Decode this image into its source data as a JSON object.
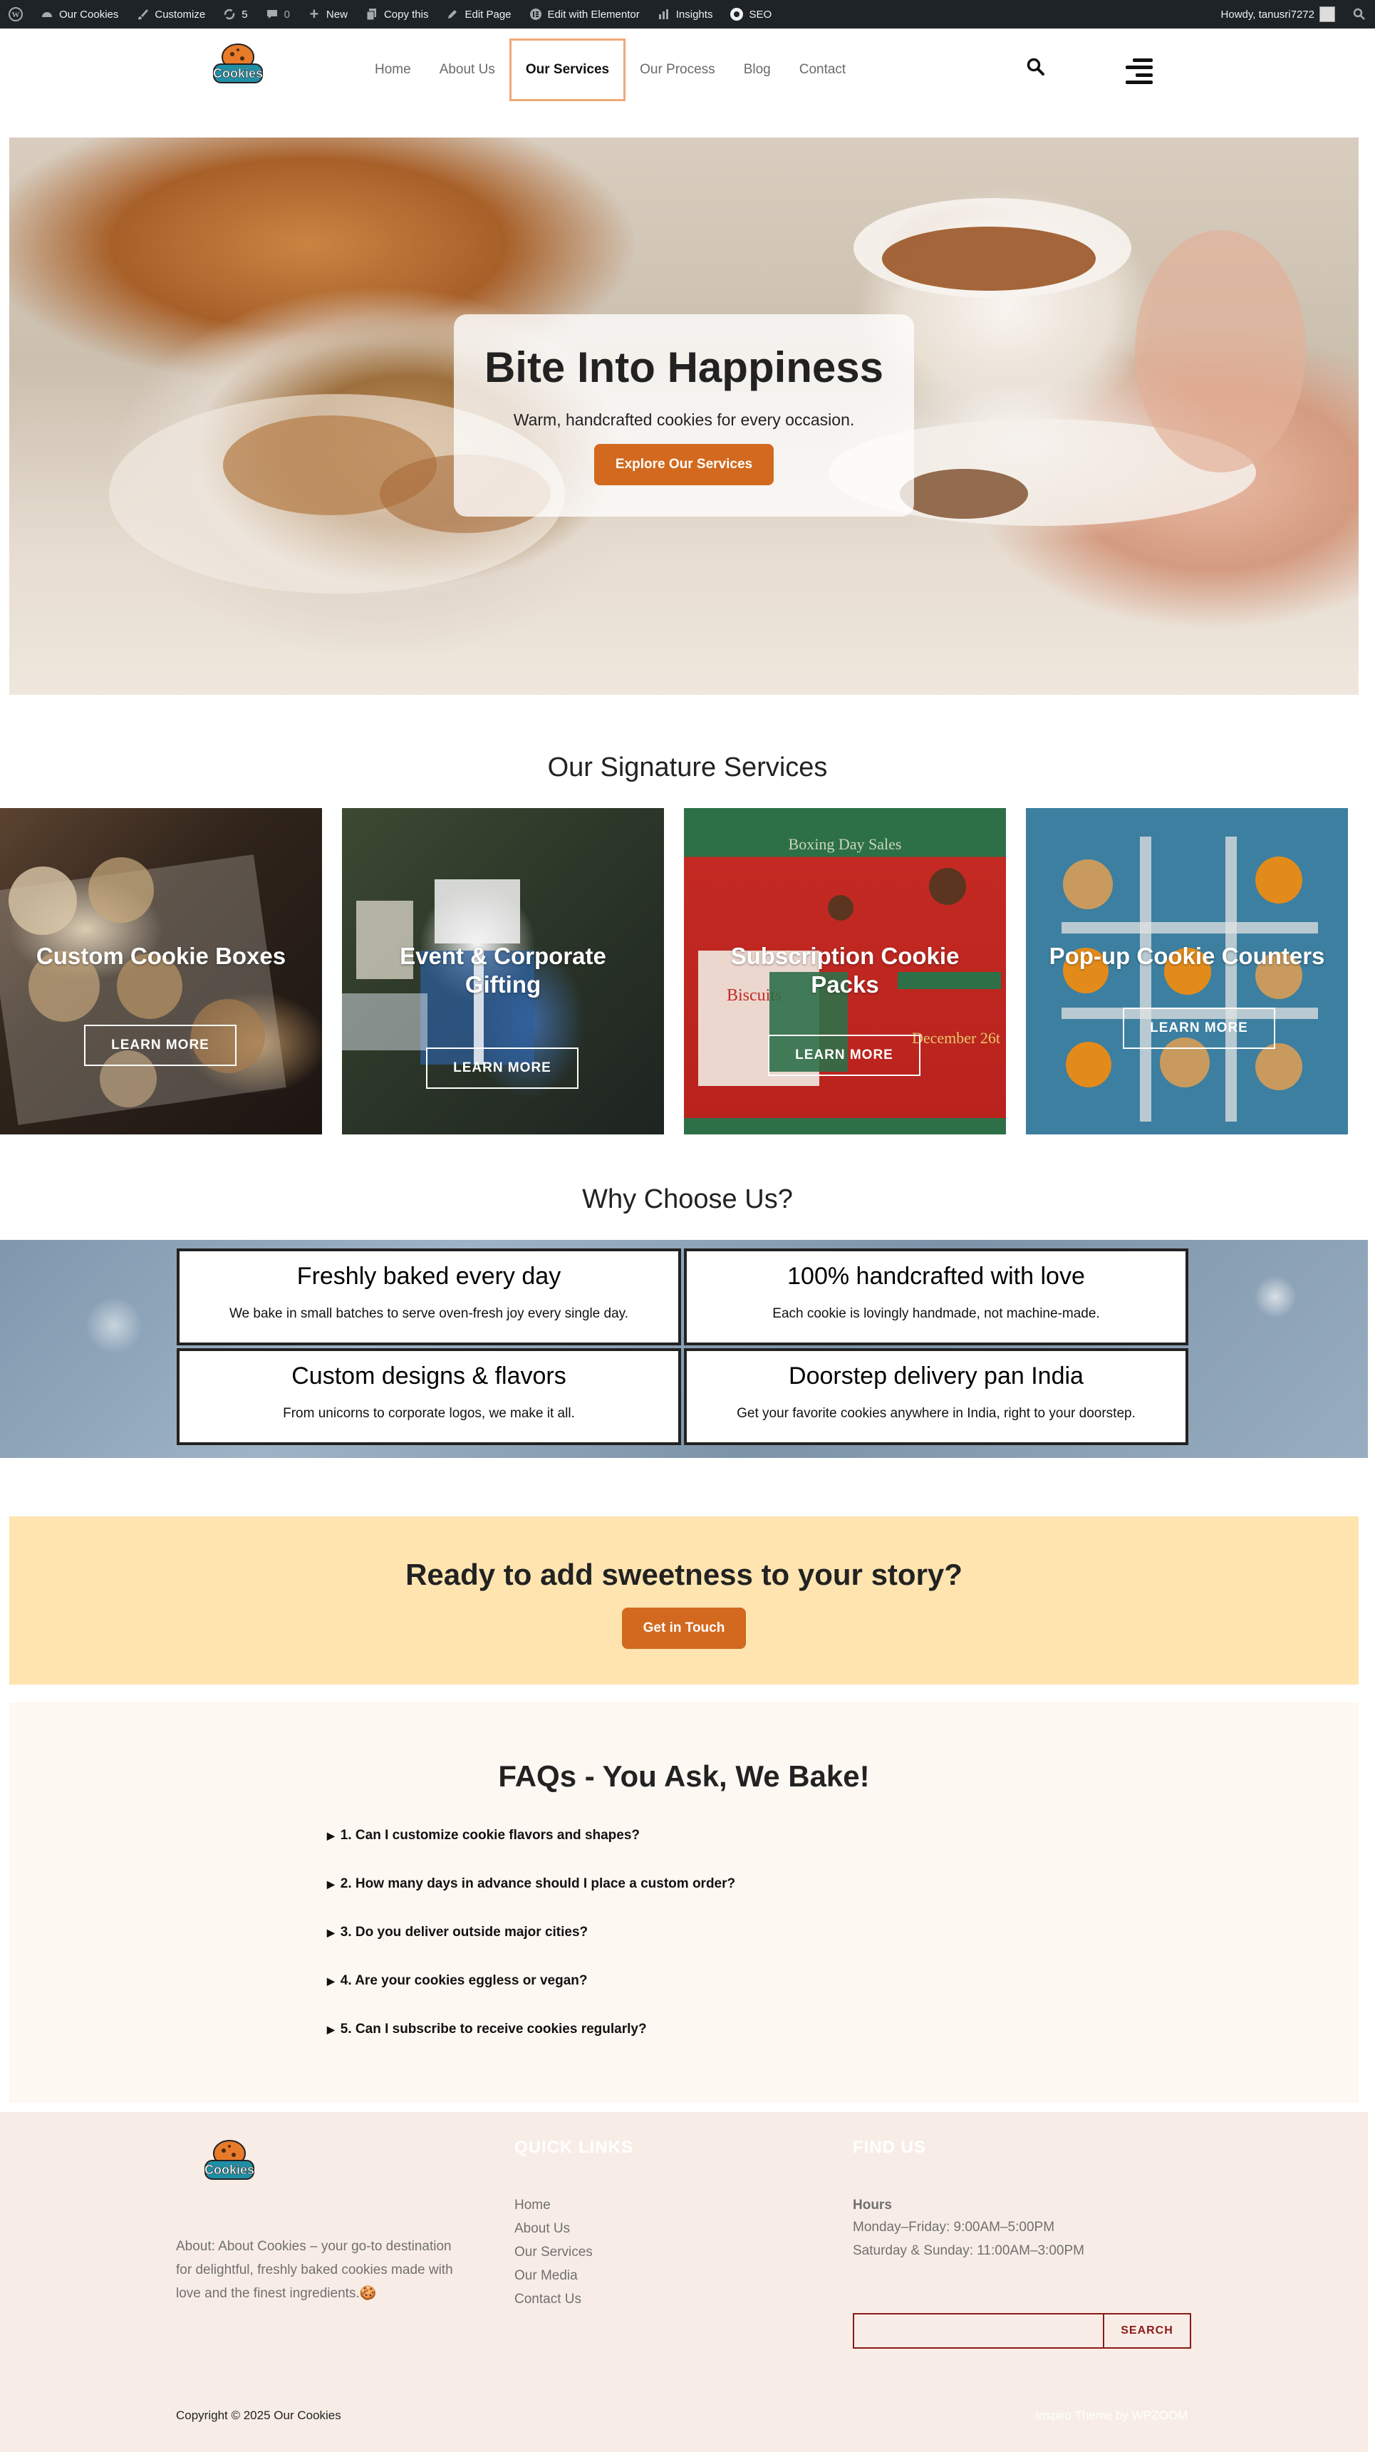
{
  "adminbar": {
    "site": "Our Cookies",
    "customize": "Customize",
    "updates": "5",
    "comments": "0",
    "new": "New",
    "copy": "Copy this",
    "edit_page": "Edit Page",
    "elementor": "Edit with Elementor",
    "insights": "Insights",
    "seo": "SEO",
    "howdy": "Howdy, tanusri7272"
  },
  "nav": {
    "items": [
      "Home",
      "About Us",
      "Our Services",
      "Our Process",
      "Blog",
      "Contact"
    ],
    "active": "Our Services"
  },
  "logo": {
    "text": "Cookies"
  },
  "hero": {
    "title": "Bite Into Happiness",
    "subtitle": "Warm, handcrafted cookies for every occasion.",
    "button": "Explore Our Services"
  },
  "services": {
    "title": "Our Signature Services",
    "button": "LEARN MORE",
    "items": [
      {
        "title_line1": "Custom Cookie Boxes",
        "title_line2": ""
      },
      {
        "title_line1": "Event & Corporate",
        "title_line2": "Gifting"
      },
      {
        "title_line1": "Subscription Cookie",
        "title_line2": "Packs"
      },
      {
        "title_line1": "Pop-up Cookie Counters",
        "title_line2": ""
      }
    ],
    "card3_image_text": {
      "header": "Boxing Day Sales",
      "date": "December 26t",
      "brand": "Biscuits"
    }
  },
  "why": {
    "title": "Why Choose Us?",
    "items": [
      {
        "title": "Freshly baked every day",
        "text": "We bake in small batches to serve oven-fresh joy every single day."
      },
      {
        "title": "100% handcrafted with love",
        "text": "Each cookie is lovingly handmade, not machine-made."
      },
      {
        "title": "Custom designs & flavors",
        "text": "From unicorns to corporate logos, we make it all."
      },
      {
        "title": "Doorstep delivery pan India",
        "text": "Get your favorite cookies anywhere in India, right to your doorstep."
      }
    ]
  },
  "cta": {
    "title": "Ready to add sweetness to your story?",
    "button": "Get in Touch"
  },
  "faq": {
    "title": "FAQs - You Ask, We Bake!",
    "items": [
      "1. Can I customize cookie flavors and shapes?",
      "2. How many days in advance should I place a custom order?",
      "3. Do you deliver outside major cities?",
      "4. Are your cookies eggless or vegan?",
      "5. Can I subscribe to receive cookies regularly?"
    ]
  },
  "footer": {
    "about_line1": "About: About Cookies – your go-to destination",
    "about_line2": "for delightful, freshly baked cookies made with",
    "about_line3": "love and the finest ingredients.🍪",
    "quick_links_title": "QUICK LINKS",
    "links": [
      "Home",
      "About Us",
      "Our Services",
      "Our Media",
      "Contact Us"
    ],
    "find_us_title": "FIND US",
    "hours_title": "Hours",
    "hours": [
      "Monday–Friday: 9:00AM–5:00PM",
      "Saturday & Sunday: 11:00AM–3:00PM"
    ],
    "search_button": "SEARCH",
    "copyright": "Copyright © 2025 Our Cookies",
    "credit": "Inspiro Theme by WPZOOM"
  },
  "colors": {
    "accent": "#d2691e",
    "cta_bg": "#ffe4b0",
    "adminbar": "#1d2327",
    "footer_bg": "#f8ede6"
  }
}
